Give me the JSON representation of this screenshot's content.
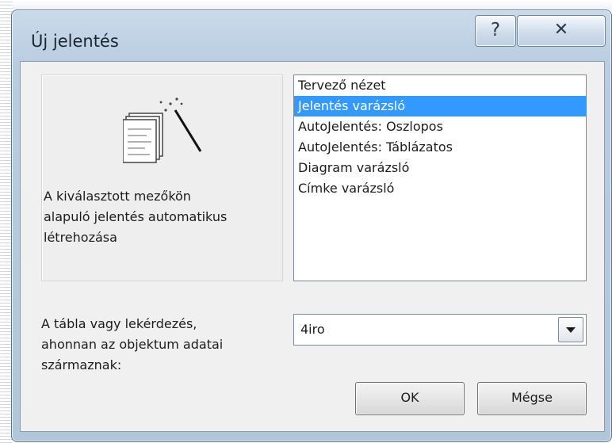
{
  "window": {
    "title": "Új jelentés",
    "help_glyph": "?",
    "close_glyph": "✕"
  },
  "preview": {
    "icon": "report-wizard-icon",
    "description": "A kiválasztott mezőkön\nalapuló jelentés automatikus\nlétrehozása"
  },
  "report_types": {
    "items": [
      "Tervező nézet",
      "Jelentés varázsló",
      "AutoJelentés: Oszlopos",
      "AutoJelentés: Táblázatos",
      "Diagram varázsló",
      "Címke varázsló"
    ],
    "selected": "Jelentés varázsló"
  },
  "source": {
    "label": "A tábla vagy lekérdezés,\nahonnan az objektum adatai\nszármaznak:",
    "value": "4iro"
  },
  "buttons": {
    "ok": "OK",
    "cancel": "Mégse"
  },
  "colors": {
    "selection": "#3399ff",
    "frame": "#b9cde0"
  }
}
